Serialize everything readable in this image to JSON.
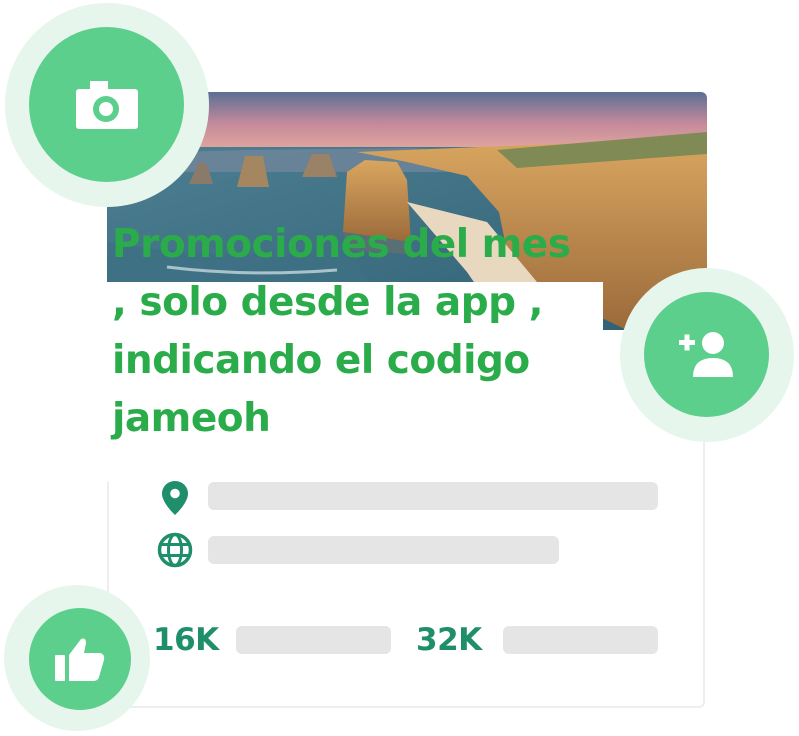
{
  "promo_text": "Promociones del mes , solo desde la app , indicando el codigo jameoh",
  "stats": [
    {
      "value": "16K"
    },
    {
      "value": "32K"
    }
  ],
  "icons": {
    "camera": "camera-icon",
    "add_user": "add-user-icon",
    "like": "thumbs-up-icon",
    "location": "location-pin-icon",
    "website": "globe-icon"
  },
  "colors": {
    "accent": "#5ccf8d",
    "halo": "#e6f6ec",
    "promo_text": "#2bac4a",
    "stat_text": "#1e8f6a",
    "placeholder_bar": "#e5e5e5"
  }
}
